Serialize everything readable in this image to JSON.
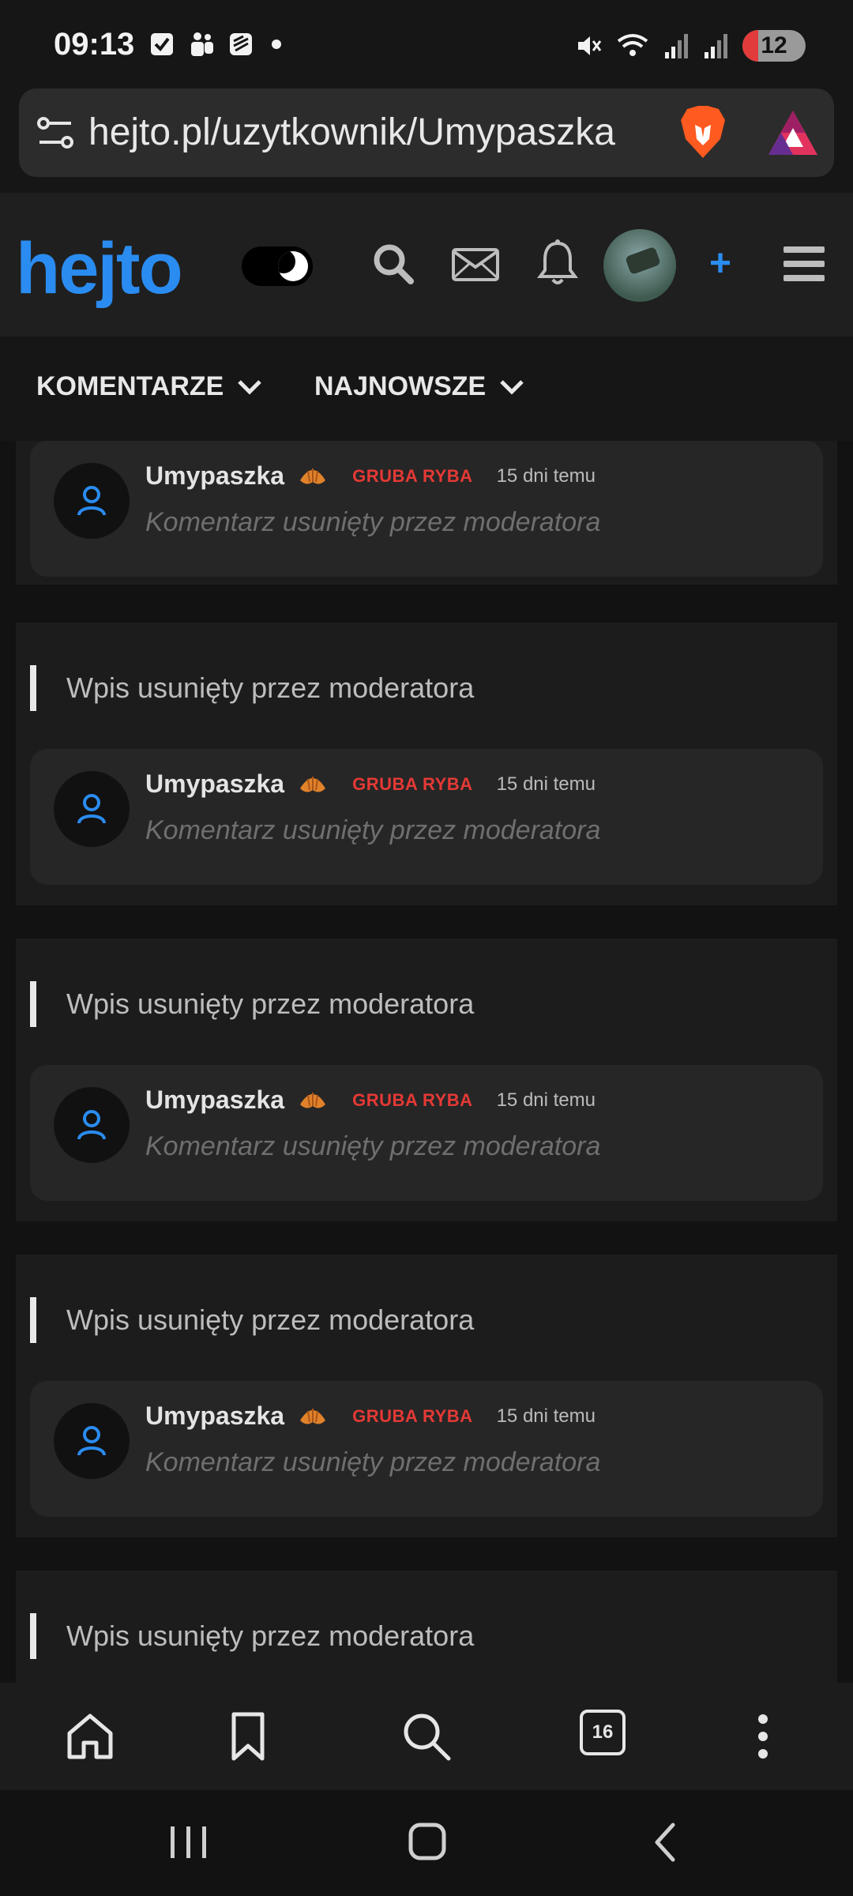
{
  "status_bar": {
    "time": "09:13",
    "battery": "12"
  },
  "address_bar": {
    "url": "hejto.pl/uzytkownik/Umypaszka"
  },
  "site_header": {
    "logo": "hejto",
    "plus": "+"
  },
  "tabs": [
    {
      "label": "KOMENTARZE"
    },
    {
      "label": "NAJNOWSZE"
    }
  ],
  "feed": {
    "items": [
      {
        "title": "",
        "comment": {
          "user": "Umypaszka",
          "rank": "GRUBA RYBA",
          "time": "15 dni temu",
          "text": "Komentarz usunięty przez moderatora"
        }
      },
      {
        "title": "Wpis usunięty przez moderatora",
        "comment": {
          "user": "Umypaszka",
          "rank": "GRUBA RYBA",
          "time": "15 dni temu",
          "text": "Komentarz usunięty przez moderatora"
        }
      },
      {
        "title": "Wpis usunięty przez moderatora",
        "comment": {
          "user": "Umypaszka",
          "rank": "GRUBA RYBA",
          "time": "15 dni temu",
          "text": "Komentarz usunięty przez moderatora"
        }
      },
      {
        "title": "Wpis usunięty przez moderatora",
        "comment": {
          "user": "Umypaszka",
          "rank": "GRUBA RYBA",
          "time": "15 dni temu",
          "text": "Komentarz usunięty przez moderatora"
        }
      },
      {
        "title": "Wpis usunięty przez moderatora"
      }
    ]
  },
  "bottom_bar": {
    "tab_count": "16"
  },
  "colors": {
    "brand": "#2a8cf0",
    "rank_red": "#e53935",
    "bg": "#121212",
    "card": "#1c1c1c",
    "comment_bg": "#262626"
  }
}
